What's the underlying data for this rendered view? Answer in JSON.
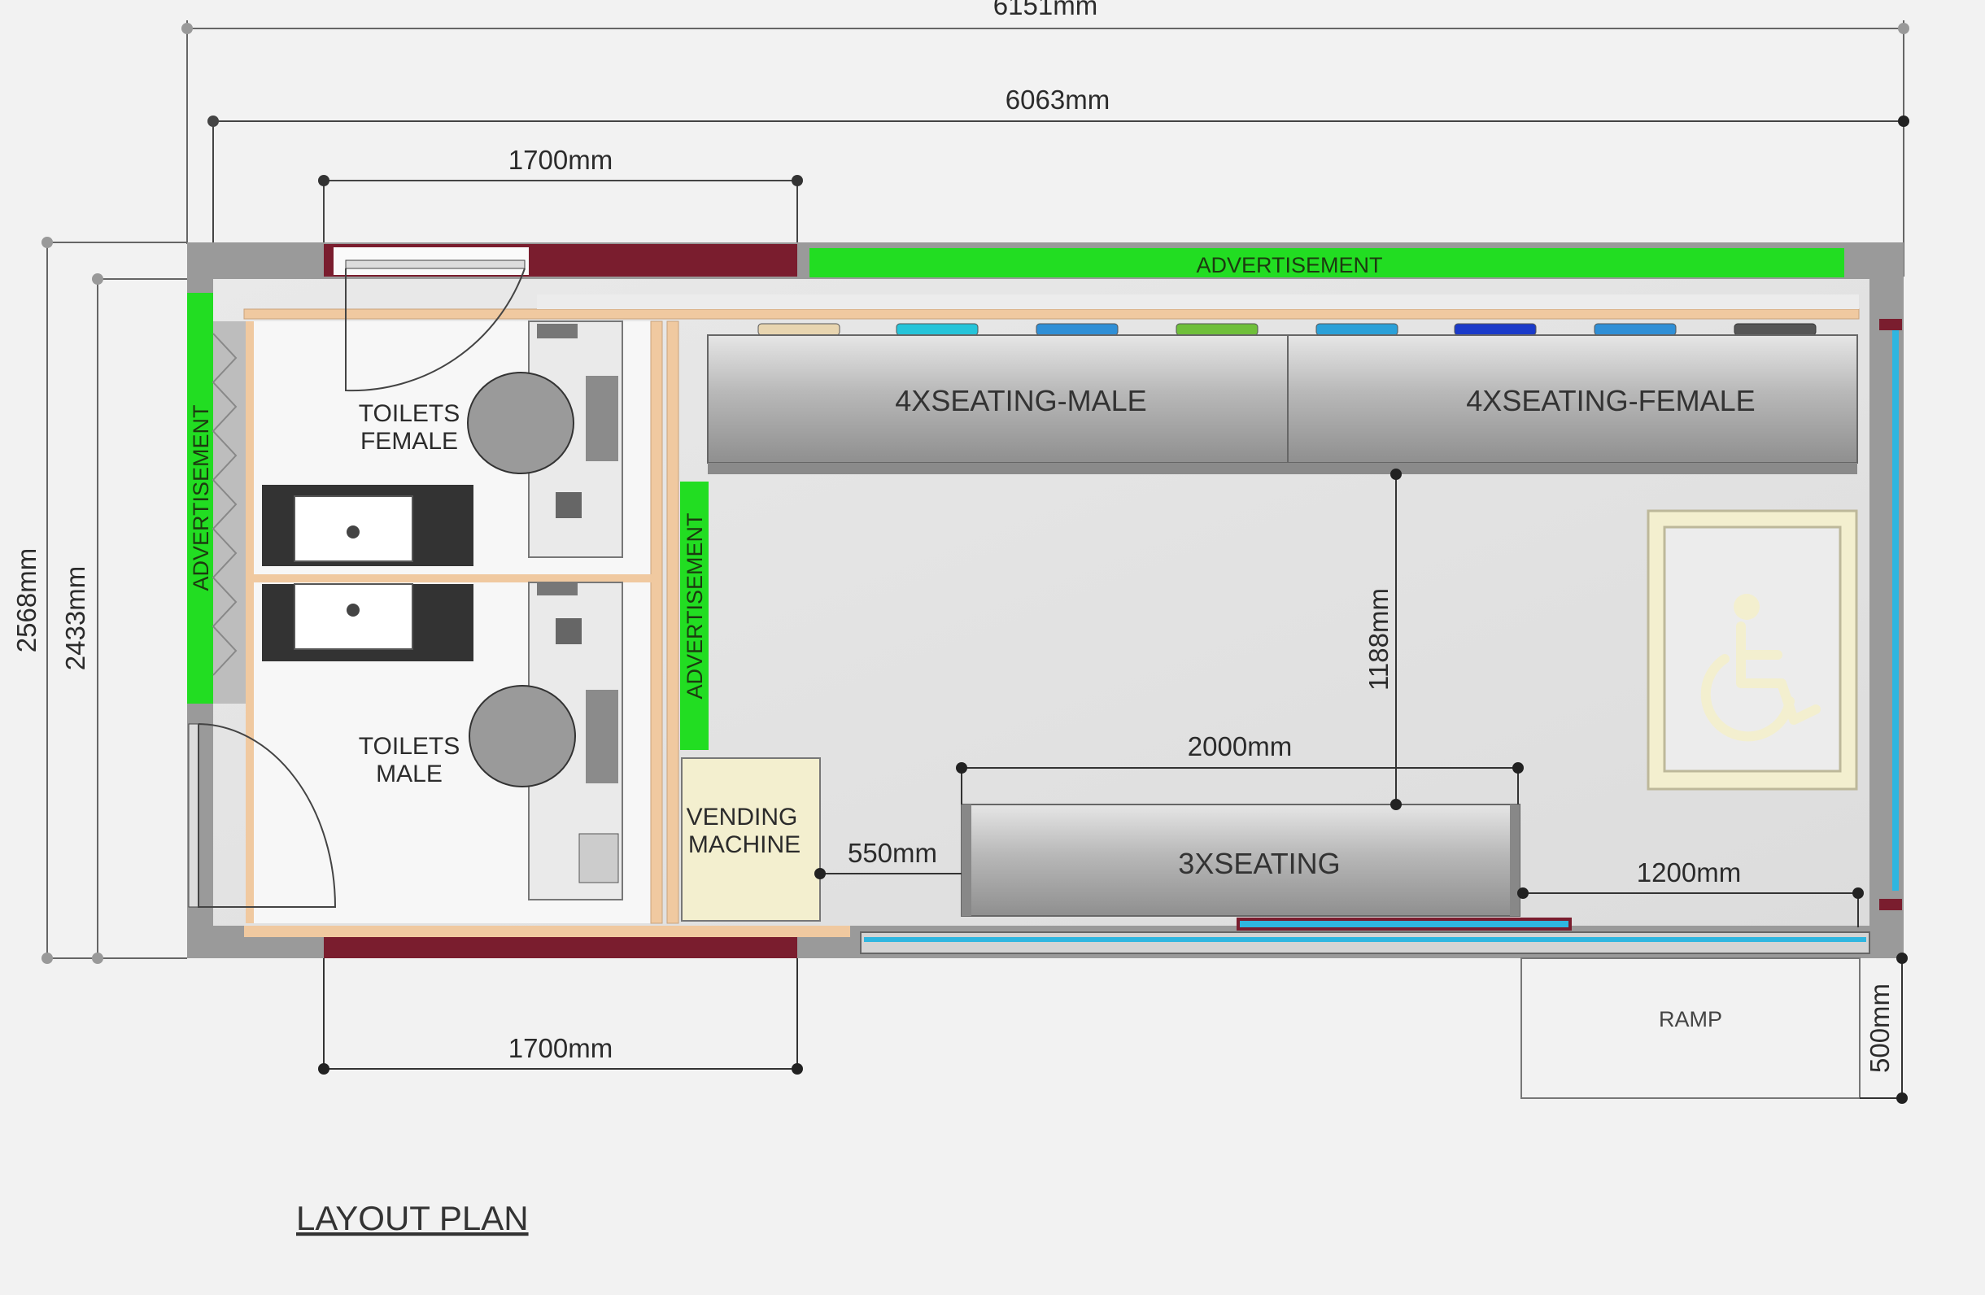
{
  "dimensions": {
    "overall_length": "6151mm",
    "inner_length": "6063mm",
    "toilet_door_top": "1700mm",
    "toilet_door_bottom": "1700mm",
    "overall_width": "2568mm",
    "inner_width": "2433mm",
    "aisle_depth": "1188mm",
    "seating_length": "2000mm",
    "vending_gap": "550mm",
    "entry_width": "1200mm",
    "ramp_depth": "500mm"
  },
  "labels": {
    "advertisement_top": "ADVERTISEMENT",
    "advertisement_left": "ADVERTISEMENT",
    "advertisement_mid": "ADVERTISEMENT",
    "seating_male": "4XSEATING-MALE",
    "seating_female": "4XSEATING-FEMALE",
    "seating_three": "3XSEATING",
    "toilets_female_1": "TOILETS",
    "toilets_female_2": "FEMALE",
    "toilets_male_1": "TOILETS",
    "toilets_male_2": "MALE",
    "vending_1": "VENDING",
    "vending_2": "MACHINE",
    "ramp": "RAMP"
  },
  "title": "LAYOUT PLAN",
  "colors": {
    "advertisement": "#22dd22",
    "wall": "#9a9a9a",
    "maroon_accent": "#7a1d2e",
    "timber": "#f0c9a0",
    "glass": "#2fb6e0",
    "access_symbol": "#f3efcf"
  },
  "icons": {
    "accessible": "wheelchair-icon"
  }
}
